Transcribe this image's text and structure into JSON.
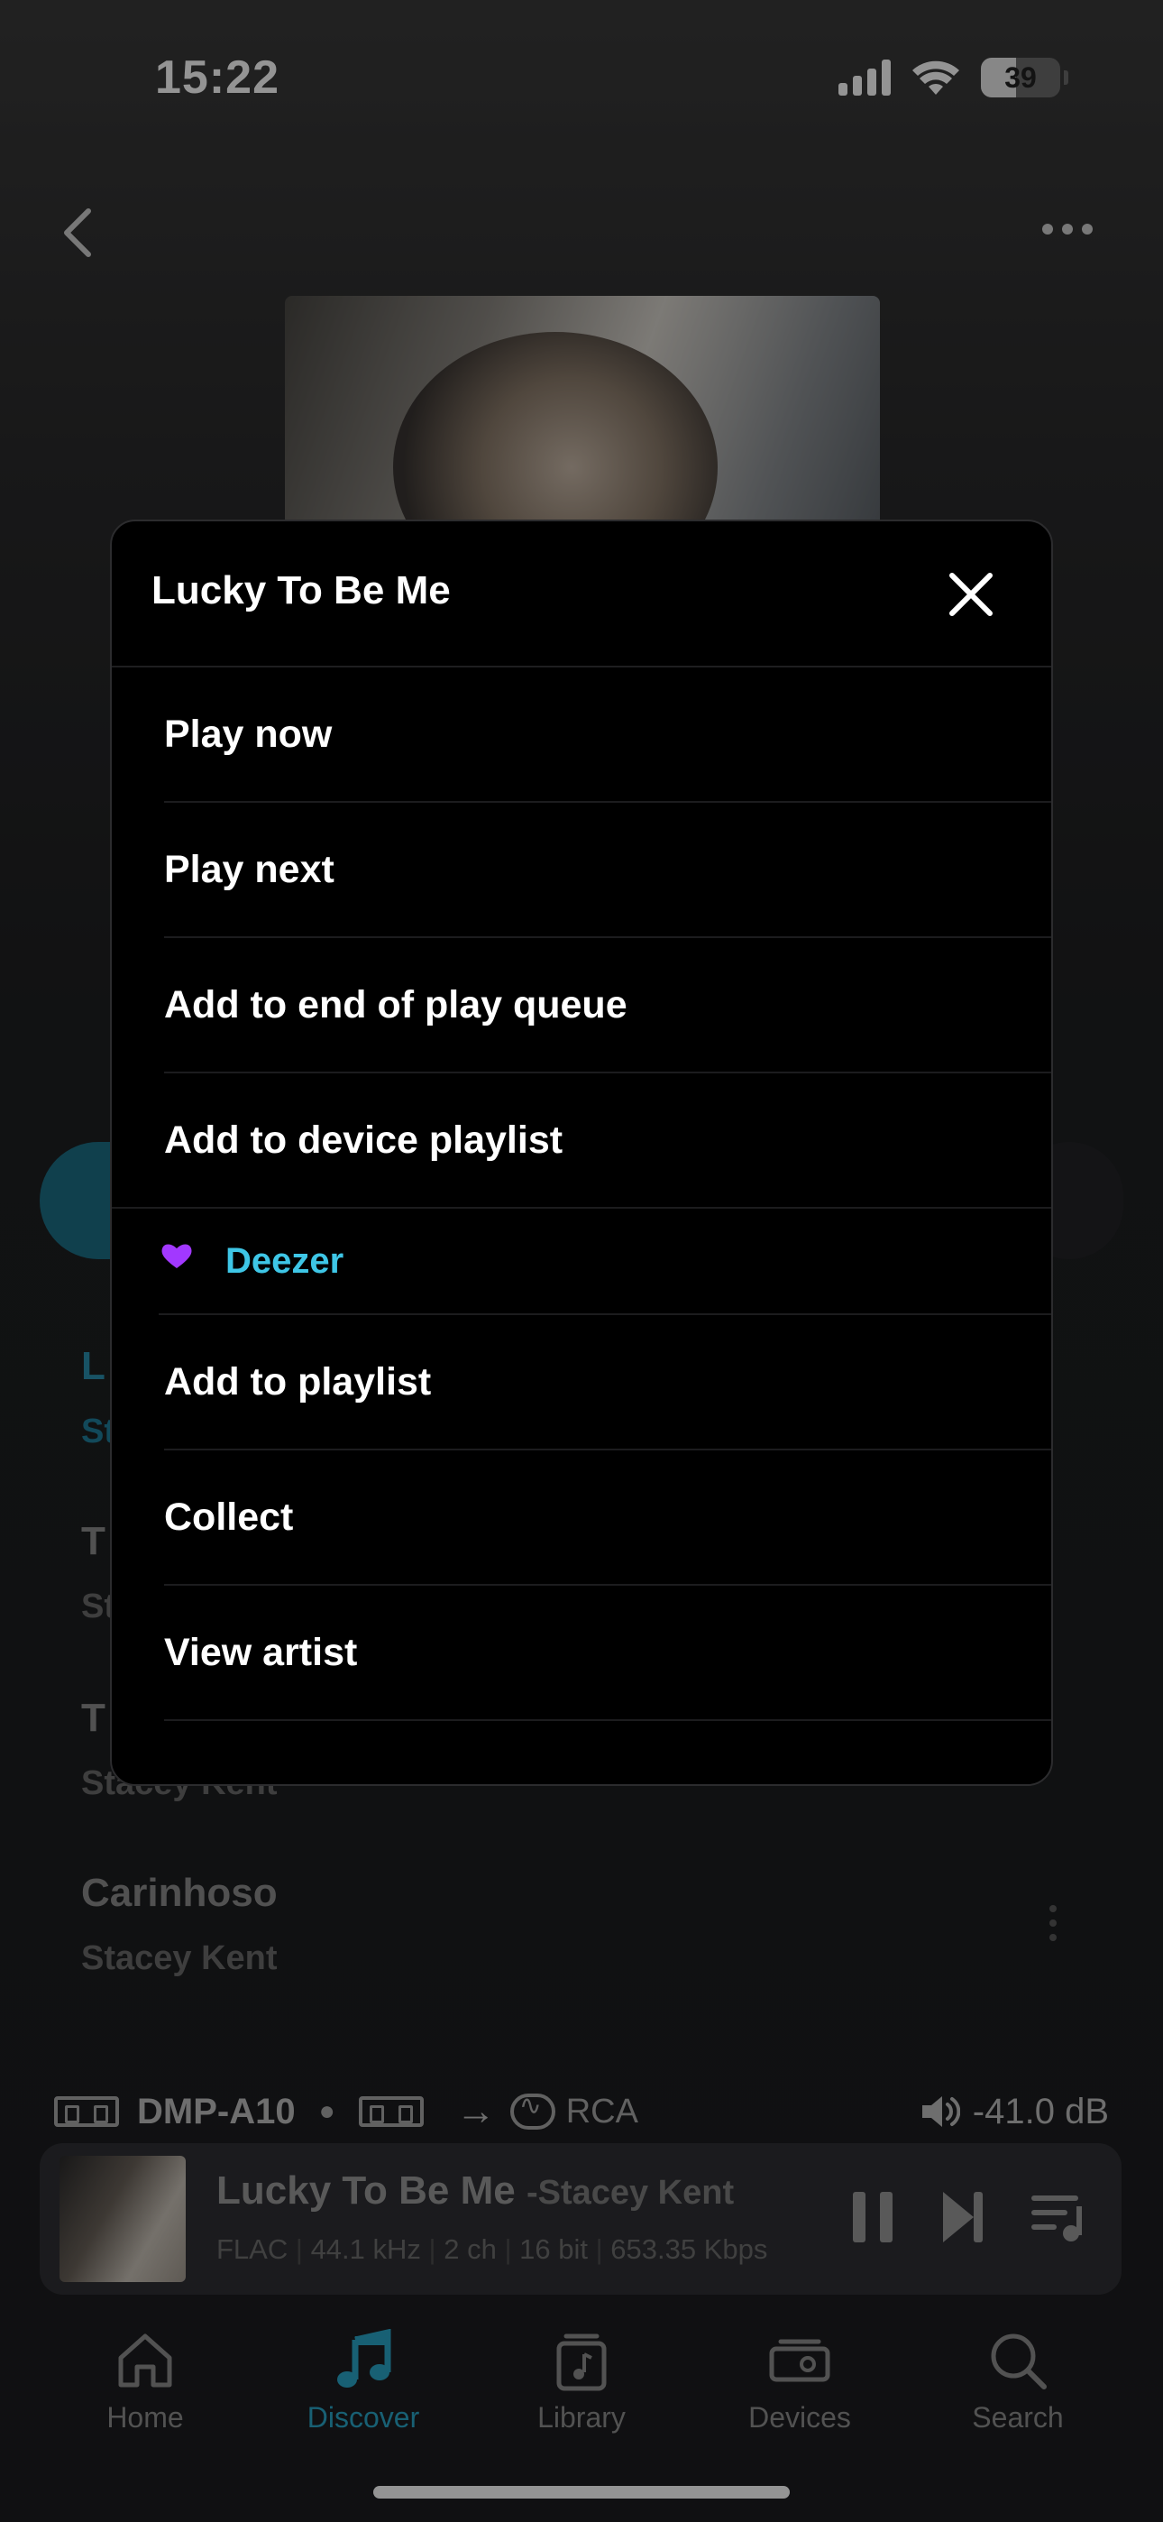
{
  "status_bar": {
    "time": "15:22",
    "battery": "39"
  },
  "background": {
    "tracks": [
      {
        "title": "L",
        "artist": "St"
      },
      {
        "title": "T",
        "artist": "St"
      },
      {
        "title": "T",
        "artist": "Stacey Kent"
      },
      {
        "title": "Carinhoso",
        "artist": "Stacey Kent"
      }
    ]
  },
  "device_row": {
    "device": "DMP-A10",
    "output": "RCA",
    "volume": "-41.0 dB"
  },
  "now_playing": {
    "title": "Lucky To Be Me",
    "artist": "-Stacey Kent",
    "format": "FLAC",
    "sample_rate": "44.1 kHz",
    "channels": "2 ch",
    "bit_depth": "16 bit",
    "bitrate": "653.35 Kbps"
  },
  "tabs": [
    {
      "label": "Home",
      "icon": "home-icon"
    },
    {
      "label": "Discover",
      "icon": "music-note-icon",
      "active": true
    },
    {
      "label": "Library",
      "icon": "library-icon"
    },
    {
      "label": "Devices",
      "icon": "devices-icon"
    },
    {
      "label": "Search",
      "icon": "search-icon"
    }
  ],
  "sheet": {
    "title": "Lucky To Be Me",
    "local_items": [
      "Play now",
      "Play next",
      "Add to end of play queue",
      "Add to device playlist"
    ],
    "provider": {
      "name": "Deezer",
      "logo_text": "DEEZER",
      "color": "#3ec6e6"
    },
    "provider_items": [
      "Add to playlist",
      "Collect",
      "View artist"
    ]
  },
  "colors": {
    "accent": "#2aa6c8",
    "deezer": "#a238ff"
  }
}
